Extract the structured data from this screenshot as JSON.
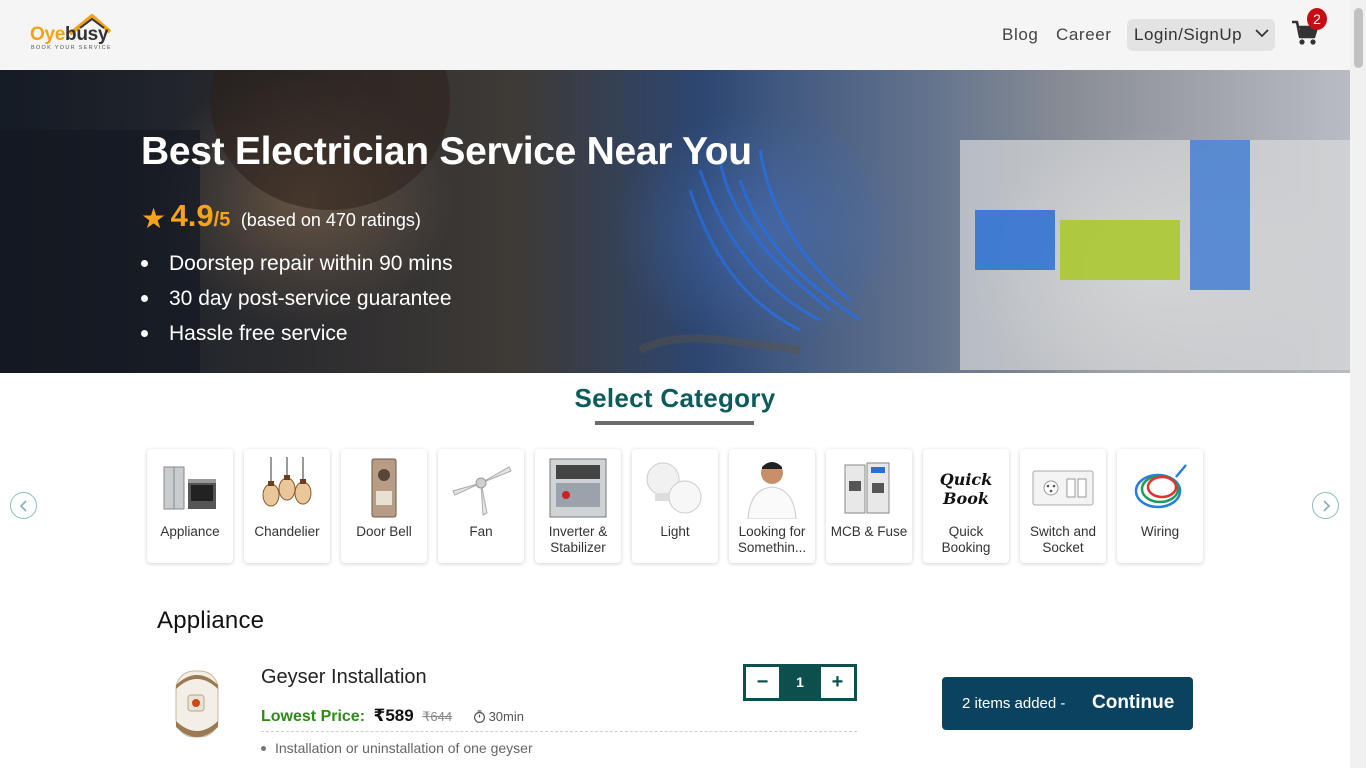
{
  "header": {
    "logo": {
      "oye": "Oye",
      "busy": "busy",
      "tagline": "BOOK YOUR SERVICE"
    },
    "nav": {
      "blog": "Blog",
      "career": "Career",
      "login": "Login/SignUp"
    },
    "cart_count": "2"
  },
  "hero": {
    "title": "Best Electrician Service Near You",
    "rating": "4.9",
    "rating_out_of": "/5",
    "rating_count": "(based on 470 ratings)",
    "features": [
      "Doorstep repair within 90 mins",
      "30 day post-service guarantee",
      "Hassle free service"
    ]
  },
  "categories": {
    "title": "Select Category",
    "items": [
      {
        "label": "Appliance",
        "icon": "appliance-icon"
      },
      {
        "label": "Chandelier",
        "icon": "chandelier-icon"
      },
      {
        "label": "Door Bell",
        "icon": "door-bell-icon"
      },
      {
        "label": "Fan",
        "icon": "fan-icon"
      },
      {
        "label": "Inverter & Stabilizer",
        "icon": "inverter-icon"
      },
      {
        "label": "Light",
        "icon": "light-icon"
      },
      {
        "label": "Looking for Somethin...",
        "icon": "person-icon"
      },
      {
        "label": "MCB & Fuse",
        "icon": "mcb-icon"
      },
      {
        "label": "Quick Booking",
        "icon": "quick-book-icon",
        "icon_text": "Quick Book"
      },
      {
        "label": "Switch and Socket",
        "icon": "switch-socket-icon"
      },
      {
        "label": "Wiring",
        "icon": "wiring-icon"
      }
    ]
  },
  "section": {
    "title": "Appliance",
    "product": {
      "name": "Geyser Installation",
      "price_label": "Lowest Price:",
      "price": "₹589",
      "old_price": "₹644",
      "duration": "30min",
      "quantity": "1",
      "features": [
        "Installation or uninstallation of one geyser"
      ]
    }
  },
  "cart_bar": {
    "added": "2 items added -",
    "continue": "Continue"
  },
  "colors": {
    "brand_orange": "#f3a21b",
    "teal": "#0d5b5a",
    "continue_bg": "#0b4260",
    "price_green": "#2e8a19",
    "badge_red": "#c40e15"
  }
}
